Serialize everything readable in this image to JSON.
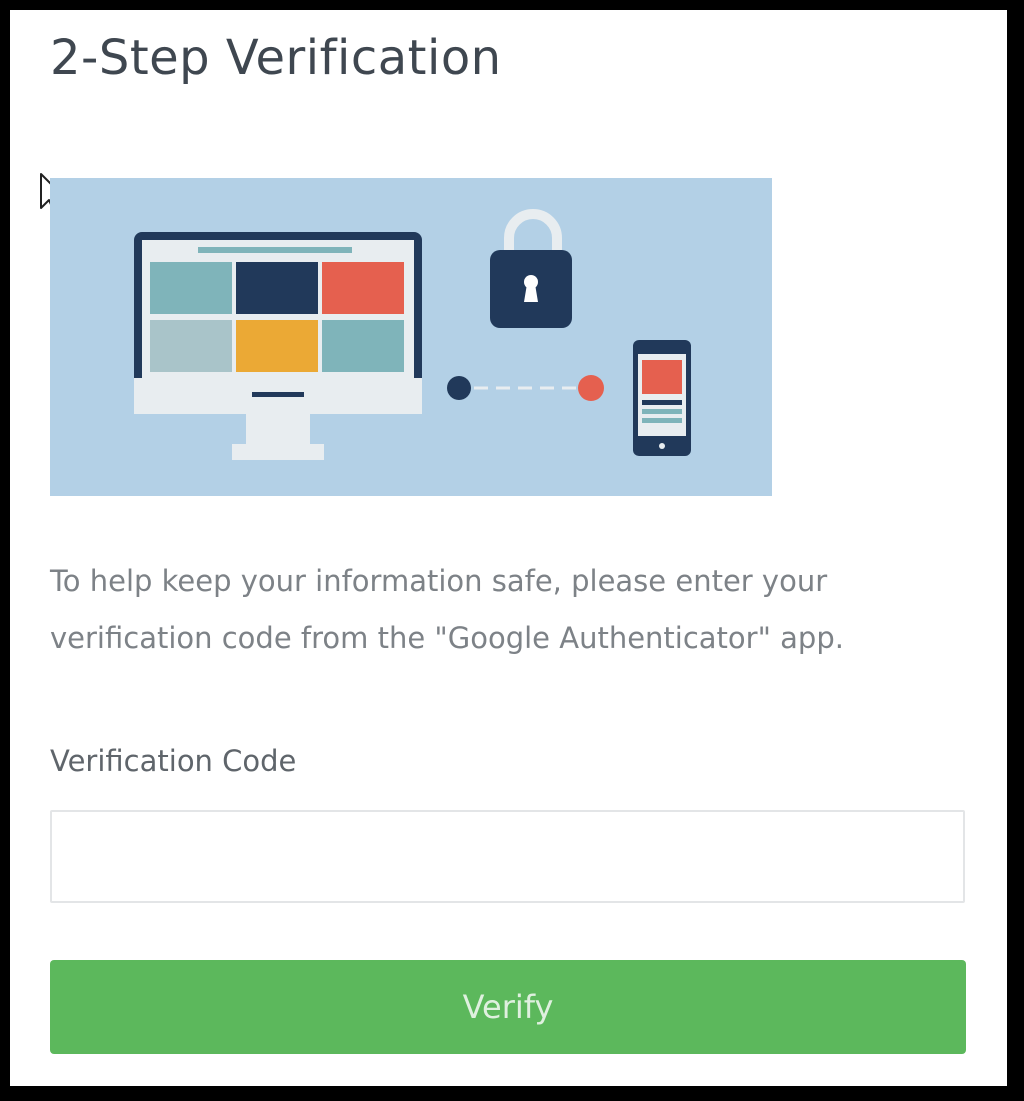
{
  "page": {
    "title": "2-Step Verification",
    "message": "To help keep your information safe, please enter your verification code from the \"Google Authenticator\" app."
  },
  "form": {
    "field_label": "Verification Code",
    "code_value": "",
    "submit_label": "Verify"
  },
  "icons": {
    "cursor": "mouse-pointer-icon",
    "banner": [
      "desktop-monitor-icon",
      "padlock-icon",
      "connection-link-icon",
      "smartphone-icon"
    ]
  },
  "colors": {
    "banner_background": "#b3d0e6",
    "button": "#5cb85c",
    "title_text": "#3f4750",
    "body_text": "#7d8287",
    "accent_navy": "#21395a",
    "accent_red": "#e5604f",
    "accent_orange": "#eba935",
    "accent_teal": "#7fb4ba"
  }
}
